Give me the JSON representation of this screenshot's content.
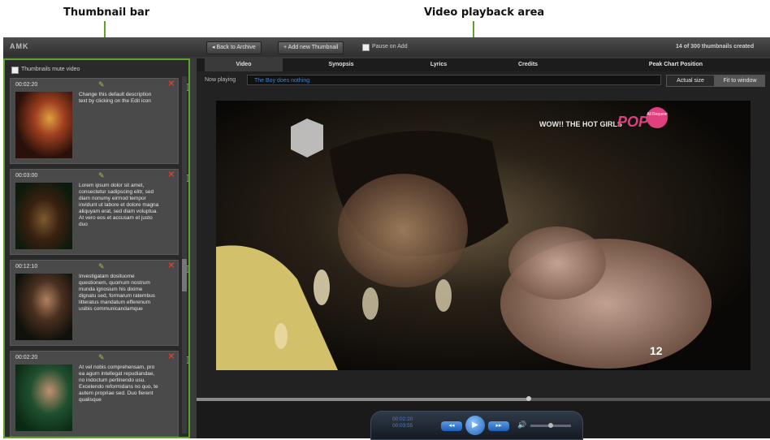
{
  "annotations": {
    "thumbnail_bar": "Thumbnail bar",
    "video_playback_area": "Video playback area"
  },
  "topbar": {
    "logo": "AMK",
    "back_button": "Back to Archive",
    "add_thumbnail_button": "Add new Thumbnail",
    "pause_label": "Pause on Add",
    "thumb_count": "14 of 300 thumbnails created"
  },
  "thumbbar": {
    "mute_label": "Thumbnails mute video",
    "items": [
      {
        "time": "00:02:20",
        "desc": "Change this default description text by clicking on the Edit icon"
      },
      {
        "time": "00:03:00",
        "desc": "Lorem ipsum dolor sit amet, consectetur sadipscing elitr, sed diam nonumy eirmod tempor invidunt ut labore et dolore magna aliquyam erat, sed diam voluptua. At vero eos et accusam et justo duo"
      },
      {
        "time": "00:12:10",
        "desc": "Investigatam dosituome questionem, quomum nostrum munda ignosium his dixime dignatu sed, formarum ratembus litteratus mandatum efferenum usibis communicandamque"
      },
      {
        "time": "00:02:20",
        "desc": "At vel nobis comprehensam, pro ea agurn intellegat repudiandae, no indoctum pertinendo usu. Excetendo reformidans no quo, te autem propriae sed. Duo fierent qualisque"
      }
    ]
  },
  "tabs": [
    "Video",
    "Synopsis",
    "Lyrics",
    "Credits",
    "Peak Chart Position"
  ],
  "now_playing": {
    "label": "Now playing",
    "value": "The Boy does nothing",
    "actual_size": "Actual size",
    "fit_window": "Fit to window"
  },
  "video": {
    "overlay_text": "WOW!! THE HOT GIRLS",
    "pop_text": "POP",
    "badge": "All Request",
    "channel": "12"
  },
  "controls": {
    "time_current": "00:02:20",
    "time_total": "00:03:55",
    "rewind": "◂◂",
    "play": "▶",
    "forward": "▸▸",
    "volume_icon": "🔊",
    "progress": 0.58,
    "volume": 0.5
  }
}
